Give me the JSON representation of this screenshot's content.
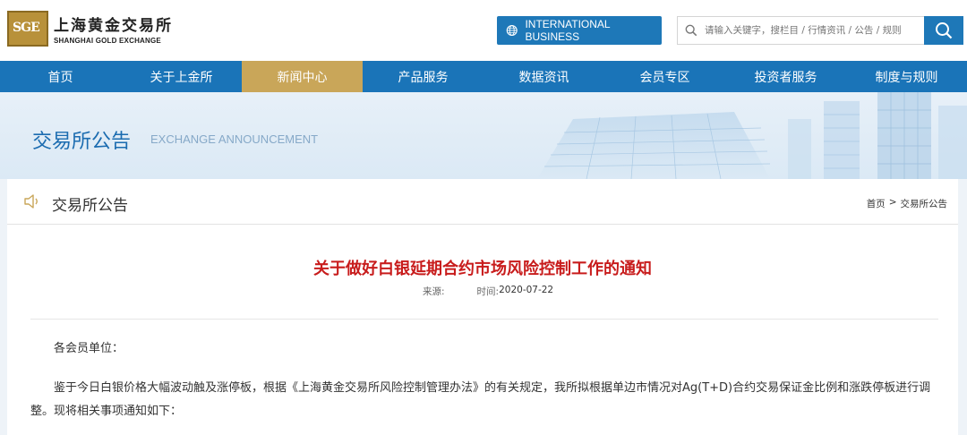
{
  "header": {
    "logo_mark": "SGE",
    "logo_cn": "上海黄金交易所",
    "logo_en": "SHANGHAI GOLD EXCHANGE",
    "intl_button": "INTERNATIONAL BUSINESS",
    "search_placeholder": "请输入关键字，搜栏目 / 行情资讯 / 公告 / 规则"
  },
  "nav": {
    "items": [
      {
        "label": "首页",
        "active": false
      },
      {
        "label": "关于上金所",
        "active": false
      },
      {
        "label": "新闻中心",
        "active": true
      },
      {
        "label": "产品服务",
        "active": false
      },
      {
        "label": "数据资讯",
        "active": false
      },
      {
        "label": "会员专区",
        "active": false
      },
      {
        "label": "投资者服务",
        "active": false
      },
      {
        "label": "制度与规则",
        "active": false
      }
    ]
  },
  "banner": {
    "title": "交易所公告",
    "subtitle": "EXCHANGE ANNOUNCEMENT"
  },
  "section": {
    "title": "交易所公告",
    "breadcrumb": [
      "首页",
      ">",
      "交易所公告"
    ]
  },
  "article": {
    "title": "关于做好白银延期合约市场风险控制工作的通知",
    "source_label": "来源:",
    "time_label": "时间:",
    "time_value": "2020-07-22",
    "salutation": "各会员单位：",
    "paragraph1": "鉴于今日白银价格大幅波动触及涨停板，根据《上海黄金交易所风险控制管理办法》的有关规定，我所拟根据单边市情况对Ag(T+D)合约交易保证金比例和涨跌停板进行调整。现将相关事项通知如下："
  },
  "colors": {
    "brand_blue": "#1a74b8",
    "nav_active_gold": "#c9a659",
    "title_red": "#c81c1c"
  }
}
